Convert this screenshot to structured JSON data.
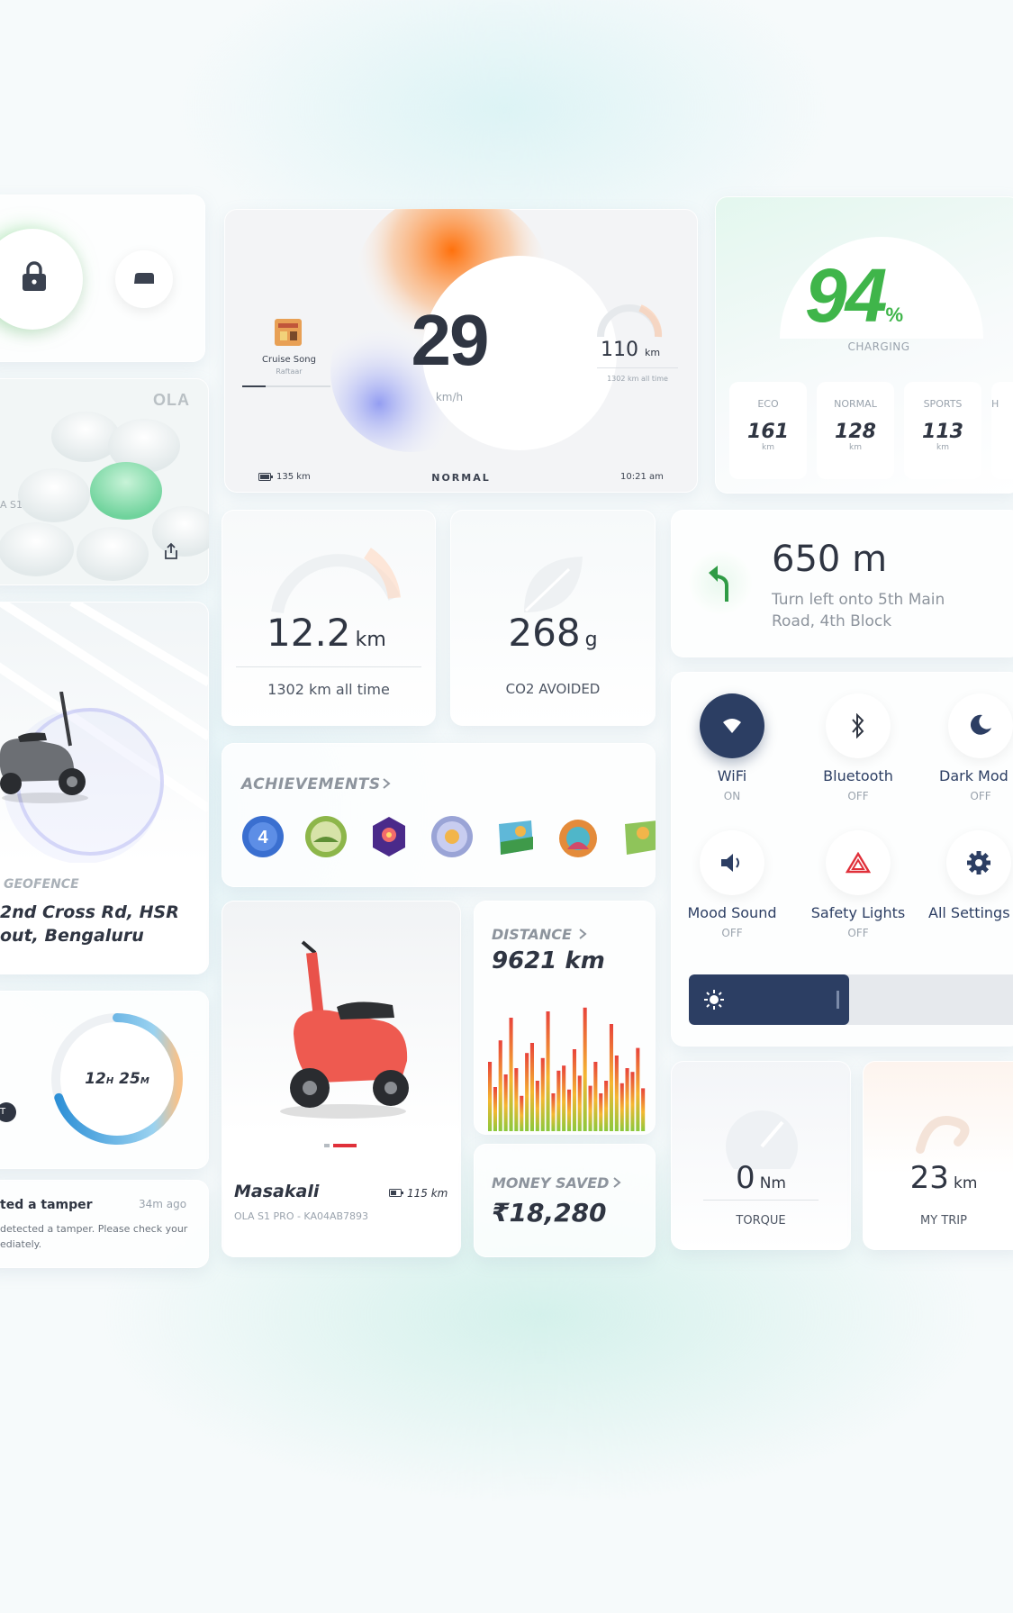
{
  "lock_card": {
    "lock_icon": "lock-icon",
    "seat_icon": "seat-icon"
  },
  "ola_card": {
    "brand": "OLA",
    "model_partial": "A S1",
    "share_icon": "share-icon"
  },
  "speed_card": {
    "song_title": "Cruise Song",
    "song_artist": "Raftaar",
    "speed": "29",
    "speed_unit": "km/h",
    "odo_value": "110",
    "odo_unit": "km",
    "odo_sub": "1302 km all time",
    "range": "135 km",
    "mode": "NORMAL",
    "time": "10:21 am"
  },
  "charge_card": {
    "percent": "94",
    "percent_sign": "%",
    "status": "CHARGING",
    "modes": [
      {
        "name": "ECO",
        "value": "161",
        "unit": "km"
      },
      {
        "name": "NORMAL",
        "value": "128",
        "unit": "km"
      },
      {
        "name": "SPORTS",
        "value": "113",
        "unit": "km"
      },
      {
        "name": "H",
        "value": "",
        "unit": ""
      }
    ]
  },
  "trip_card": {
    "value": "12.2",
    "unit": "km",
    "sub": "1302 km all time"
  },
  "co2_card": {
    "value": "268",
    "unit": "g",
    "label": "CO2 AVOIDED"
  },
  "nav_card": {
    "distance": "650 m",
    "instruction": "Turn left onto 5th Main Road, 4th Block"
  },
  "geofence_card": {
    "label": "GEOFENCE",
    "address": "2nd Cross Rd, HSR\nout, Bengaluru"
  },
  "achievements": {
    "title": "ACHIEVEMENTS",
    "badges": [
      "badge-4",
      "badge-ride",
      "badge-galaxy",
      "badge-refer",
      "badge-map-1",
      "badge-map-2",
      "badge-map-3"
    ]
  },
  "controls": {
    "items": [
      {
        "label": "WiFi",
        "state": "ON",
        "icon": "wifi-icon"
      },
      {
        "label": "Bluetooth",
        "state": "OFF",
        "icon": "bluetooth-icon"
      },
      {
        "label": "Dark Mod",
        "state": "OFF",
        "icon": "moon-icon"
      },
      {
        "label": "Mood Sound",
        "state": "OFF",
        "icon": "speaker-icon"
      },
      {
        "label": "Safety Lights",
        "state": "OFF",
        "icon": "hazard-icon"
      },
      {
        "label": "All Settings",
        "state": "",
        "icon": "gear-icon"
      }
    ],
    "brightness_fraction": 0.48
  },
  "timer_card": {
    "hours": "12",
    "h_unit": "H",
    "minutes": "25",
    "m_unit": "M",
    "badge": "T",
    "progress": 0.7
  },
  "vehicle_card": {
    "name": "Masakali",
    "range": "115 km",
    "plate": "OLA S1 PRO - KA04AB7893"
  },
  "distance_card": {
    "title": "DISTANCE",
    "value": "9621 km",
    "bars": [
      0.55,
      0.35,
      0.72,
      0.45,
      0.9,
      0.5,
      0.28,
      0.62,
      0.7,
      0.4,
      0.58,
      0.95,
      0.3,
      0.48,
      0.52,
      0.33,
      0.65,
      0.44,
      0.98,
      0.36,
      0.55,
      0.3,
      0.4,
      0.85,
      0.6,
      0.38,
      0.5,
      0.47,
      0.66,
      0.34
    ]
  },
  "money_card": {
    "title": "MONEY SAVED",
    "value": "₹18,280"
  },
  "alert_card": {
    "title": "ted a tamper",
    "time": "34m ago",
    "body": "detected a tamper. Please check your\nediately."
  },
  "torque_card": {
    "value": "0",
    "unit": "Nm",
    "label": "TORQUE"
  },
  "mytrip_card": {
    "value": "23",
    "unit": "km",
    "label": "MY TRIP"
  },
  "colors": {
    "accent_green": "#3fb54a",
    "navy": "#2c3e63",
    "ring_blue": "#2c8fd6",
    "alert_red": "#e0303a"
  }
}
